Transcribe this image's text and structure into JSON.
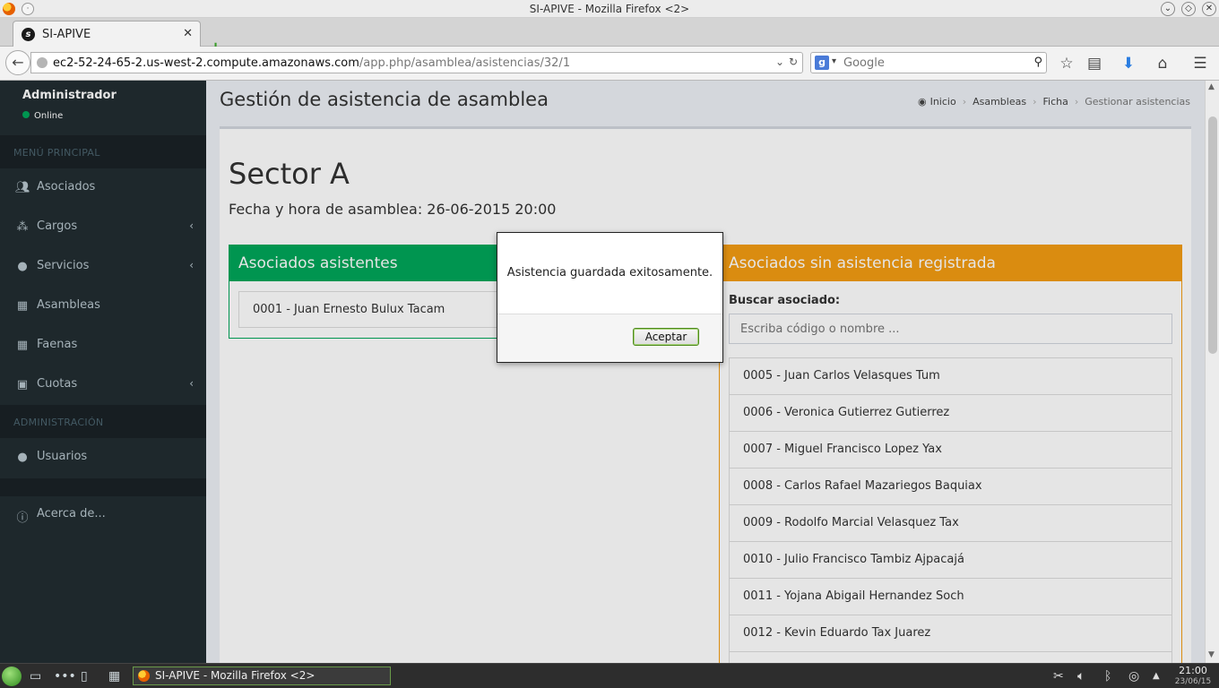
{
  "window": {
    "title": "SI-APIVE - Mozilla Firefox <2>"
  },
  "browser": {
    "tab_title": "SI-APIVE",
    "url_host": "ec2-52-24-65-2.us-west-2.compute.amazonaws.com",
    "url_path": "/app.php/asamblea/asistencias/32/1",
    "search_placeholder": "Google"
  },
  "sidebar": {
    "user_name": "Administrador",
    "user_status": "Online",
    "header_main": "MENÚ PRINCIPAL",
    "header_admin": "ADMINISTRACIÓN",
    "items": [
      {
        "label": "Asociados",
        "icon": "users-icon"
      },
      {
        "label": "Cargos",
        "icon": "sitemap-icon"
      },
      {
        "label": "Servicios",
        "icon": "tint-icon"
      },
      {
        "label": "Asambleas",
        "icon": "calendar-icon"
      },
      {
        "label": "Faenas",
        "icon": "calendar-icon"
      },
      {
        "label": "Cuotas",
        "icon": "money-icon"
      },
      {
        "label": "Usuarios",
        "icon": "user-icon"
      },
      {
        "label": "Acerca de...",
        "icon": "info-icon"
      }
    ]
  },
  "content": {
    "page_title": "Gestión de asistencia de asamblea",
    "breadcrumb": [
      "Inicio",
      "Asambleas",
      "Ficha",
      "Gestionar asistencias"
    ],
    "sector_title": "Sector A",
    "fecha_label": "Fecha y hora de asamblea: 26-06-2015 20:00"
  },
  "asistentes": {
    "title": "Asociados asistentes",
    "items": [
      "0001 - Juan Ernesto Bulux Tacam"
    ]
  },
  "sin_asistencia": {
    "title": "Asociados sin asistencia registrada",
    "search_label": "Buscar asociado:",
    "search_placeholder": "Escriba código o nombre ...",
    "items": [
      "0005 - Juan Carlos Velasques Tum",
      "0006 - Veronica Gutierrez Gutierrez",
      "0007 - Miguel Francisco Lopez Yax",
      "0008 - Carlos Rafael Mazariegos Baquiax",
      "0009 - Rodolfo Marcial Velasquez Tax",
      "0010 - Julio Francisco Tambiz Ajpacajá",
      "0011 - Yojana Abigail Hernandez Soch",
      "0012 - Kevin Eduardo Tax Juarez"
    ]
  },
  "modal": {
    "message": "Asistencia guardada exitosamente.",
    "button": "Aceptar"
  },
  "taskbar": {
    "window_label": "SI-APIVE - Mozilla Firefox <2>",
    "time": "21:00",
    "date": "23/06/15"
  },
  "colors": {
    "sidebar_bg": "#222d32",
    "green": "#00a65a",
    "orange": "#f39c12"
  }
}
